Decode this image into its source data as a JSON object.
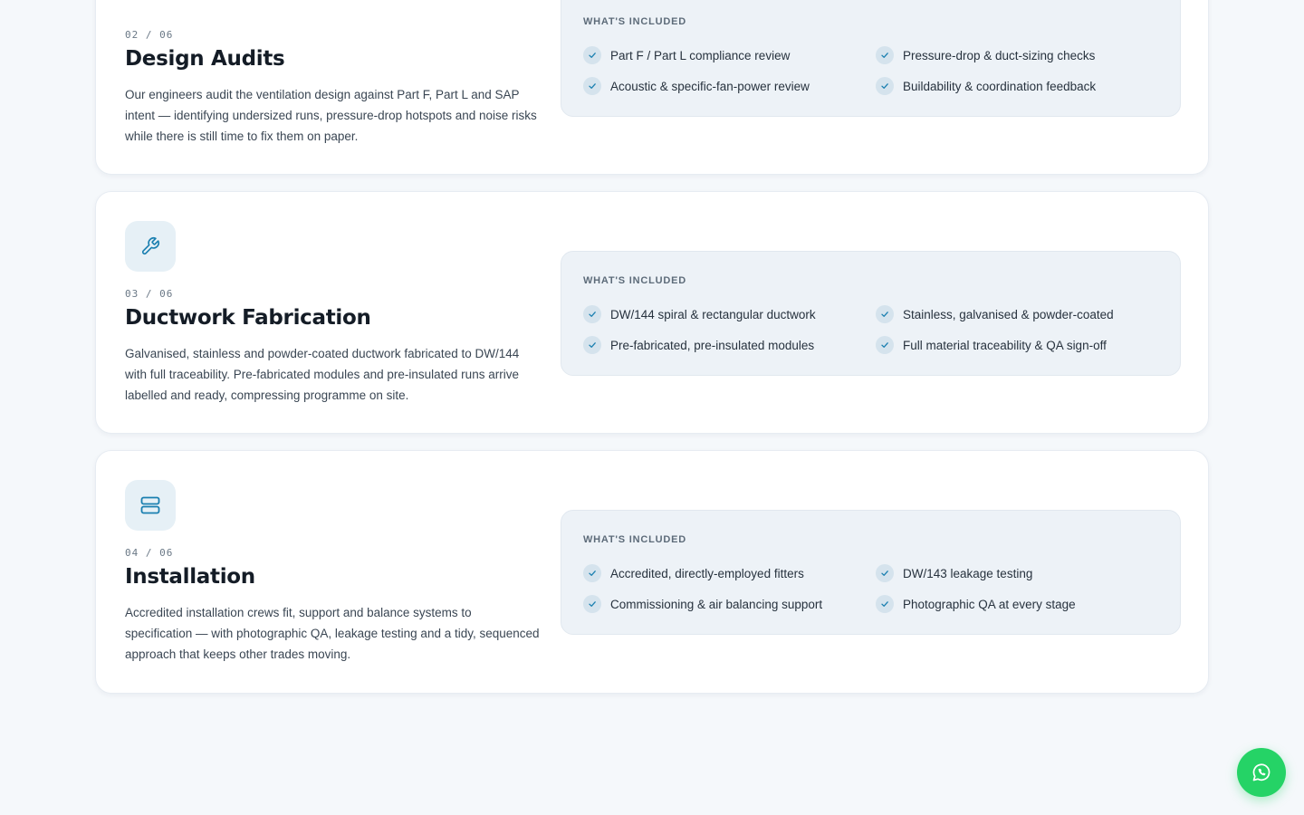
{
  "services": [
    {
      "icon": "clipboard-icon",
      "counter": "02 / 06",
      "title": "Design Audits",
      "description": "Our engineers audit the ventilation design against Part F, Part L and SAP intent — identifying undersized runs, pressure-drop hotspots and noise risks while there is still time to fix them on paper.",
      "included_label": "WHAT'S INCLUDED",
      "included": [
        "Part F / Part L compliance review",
        "Pressure-drop & duct-sizing checks",
        "Acoustic & specific-fan-power review",
        "Buildability & coordination feedback"
      ]
    },
    {
      "icon": "wrench-icon",
      "counter": "03 / 06",
      "title": "Ductwork Fabrication",
      "description": "Galvanised, stainless and powder-coated ductwork fabricated to DW/144 with full traceability. Pre-fabricated modules and pre-insulated runs arrive labelled and ready, compressing programme on site.",
      "included_label": "WHAT'S INCLUDED",
      "included": [
        "DW/144 spiral & rectangular ductwork",
        "Stainless, galvanised & powder-coated",
        "Pre-fabricated, pre-insulated modules",
        "Full material traceability & QA sign-off"
      ]
    },
    {
      "icon": "server-icon",
      "counter": "04 / 06",
      "title": "Installation",
      "description": "Accredited installation crews fit, support and balance systems to specification — with photographic QA, leakage testing and a tidy, sequenced approach that keeps other trades moving.",
      "included_label": "WHAT'S INCLUDED",
      "included": [
        "Accredited, directly-employed fitters",
        "DW/143 leakage testing",
        "Commissioning & air balancing support",
        "Photographic QA at every stage"
      ]
    }
  ],
  "whatsapp": {
    "icon": "whatsapp-icon"
  },
  "colors": {
    "page_background": "#f5f8fb",
    "accent": "#1a7fb0",
    "check_background": "#d5e3ed",
    "whatsapp_green": "#25d366"
  }
}
